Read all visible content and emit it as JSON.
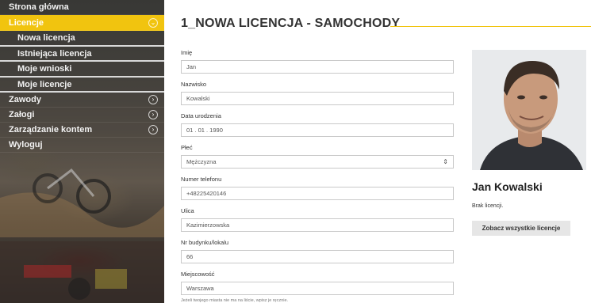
{
  "sidebar": {
    "items": [
      {
        "label": "Strona główna"
      },
      {
        "label": "Licencje"
      },
      {
        "label": "Nowa licencja"
      },
      {
        "label": "Istniejąca licencja"
      },
      {
        "label": "Moje wnioski"
      },
      {
        "label": "Moje licencje"
      },
      {
        "label": "Zawody"
      },
      {
        "label": "Załogi"
      },
      {
        "label": "Zarządzanie kontem"
      },
      {
        "label": "Wyloguj"
      }
    ],
    "accent_color": "#f1c40f"
  },
  "main": {
    "title": "1_NOWA LICENCJA - SAMOCHODY"
  },
  "form": {
    "fields": [
      {
        "label": "Imię",
        "value": "Jan"
      },
      {
        "label": "Nazwisko",
        "value": "Kowalski"
      },
      {
        "label": "Data urodzenia",
        "value": "01 . 01 . 1990"
      },
      {
        "label": "Płeć",
        "value": "Mężczyzna"
      },
      {
        "label": "Numer telefonu",
        "value": "+48225420146"
      },
      {
        "label": "Ulica",
        "value": "Kazimierzowska"
      },
      {
        "label": "Nr budynku/lokalu",
        "value": "66"
      },
      {
        "label": "Miejscowość",
        "value": "Warszawa"
      }
    ],
    "city_hint": "Jeżeli twojego miasta nie ma na liście, wpisz je ręcznie.",
    "select_arrow_icon": "updown-arrows-icon"
  },
  "profile": {
    "name": "Jan Kowalski",
    "license_status": "Brak licencji.",
    "all_licenses_button": "Zobacz wszystkie licencje"
  }
}
